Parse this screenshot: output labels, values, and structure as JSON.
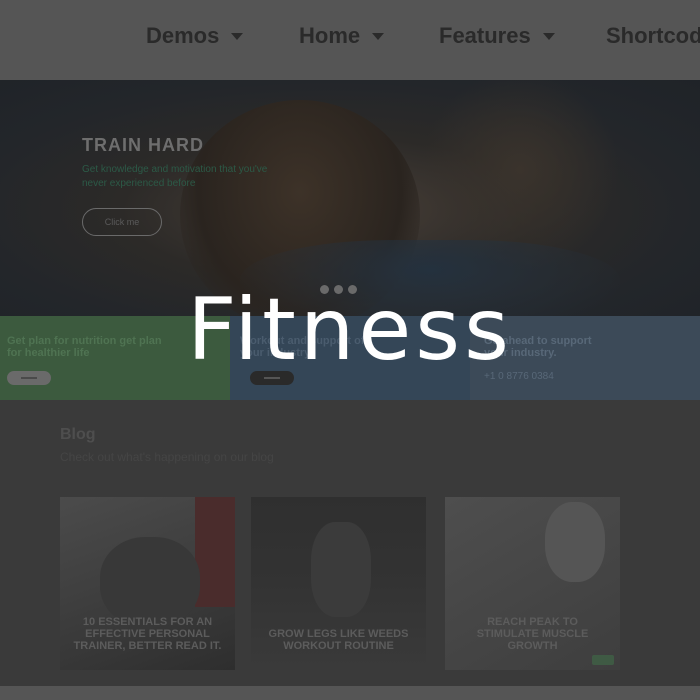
{
  "nav": {
    "items": [
      {
        "label": "Demos"
      },
      {
        "label": "Home"
      },
      {
        "label": "Features"
      },
      {
        "label": "Shortcodes"
      }
    ]
  },
  "hero": {
    "title": "TRAIN HARD",
    "subtitle": "Get knowledge and motivation that you've never experienced before",
    "button_label": "Click me",
    "slides": 3
  },
  "features": {
    "panel1_text": "Get plan for nutrition get plan for healthier life",
    "panel2_text": "Workout and support of your industry",
    "panel3_text": "Go ahead to support your industry.",
    "panel3_phone": "+1 0 8776 0384"
  },
  "overlay": {
    "title": "Fitness"
  },
  "blog": {
    "heading": "Blog",
    "subheading": "Check out what's happening on our blog",
    "posts": [
      {
        "title": "10 Essentials for an Effective Personal Trainer, Better Read It."
      },
      {
        "title": "Grow Legs Like Weeds Workout Routine"
      },
      {
        "title": "Reach Peak to Stimulate Muscle Growth"
      }
    ]
  },
  "colors": {
    "navbar": "#555555",
    "page_bg": "#3a3a3a",
    "panel_green": "#3c5a3e",
    "panel_blue": "#344657",
    "panel_slate": "#3c4a58",
    "overlay_text": "#ffffff"
  },
  "icons": {
    "nav_caret": "chevron-down-icon"
  }
}
